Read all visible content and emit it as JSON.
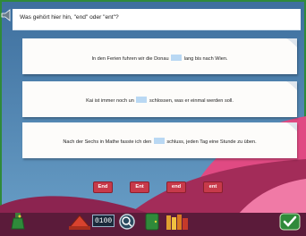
{
  "question": "Was gehört hier hin, \"end\" oder \"ent\"?",
  "sentences": [
    {
      "before": "In den Ferien fuhren wir die Donau",
      "after": "lang bis nach Wien."
    },
    {
      "before": "Kai ist immer noch un",
      "after": "schlossen, was er einmal werden soll."
    },
    {
      "before": "Nach der Sechs in Mathe fasste ich den",
      "after": "schluss, jeden Tag eine Stunde zu üben."
    }
  ],
  "answers": [
    "End",
    "Ent",
    "end",
    "ent"
  ],
  "counter": "0100",
  "colors": {
    "accent": "#c73a4a",
    "gap": "#b9d8f3",
    "background": "#4a7fb0"
  },
  "icons": [
    "speaker-icon",
    "potion-bottle-icon",
    "red-hat-icon",
    "counter-icon",
    "magnifier-icon",
    "exit-door-icon",
    "books-icon",
    "checkmark-icon"
  ]
}
